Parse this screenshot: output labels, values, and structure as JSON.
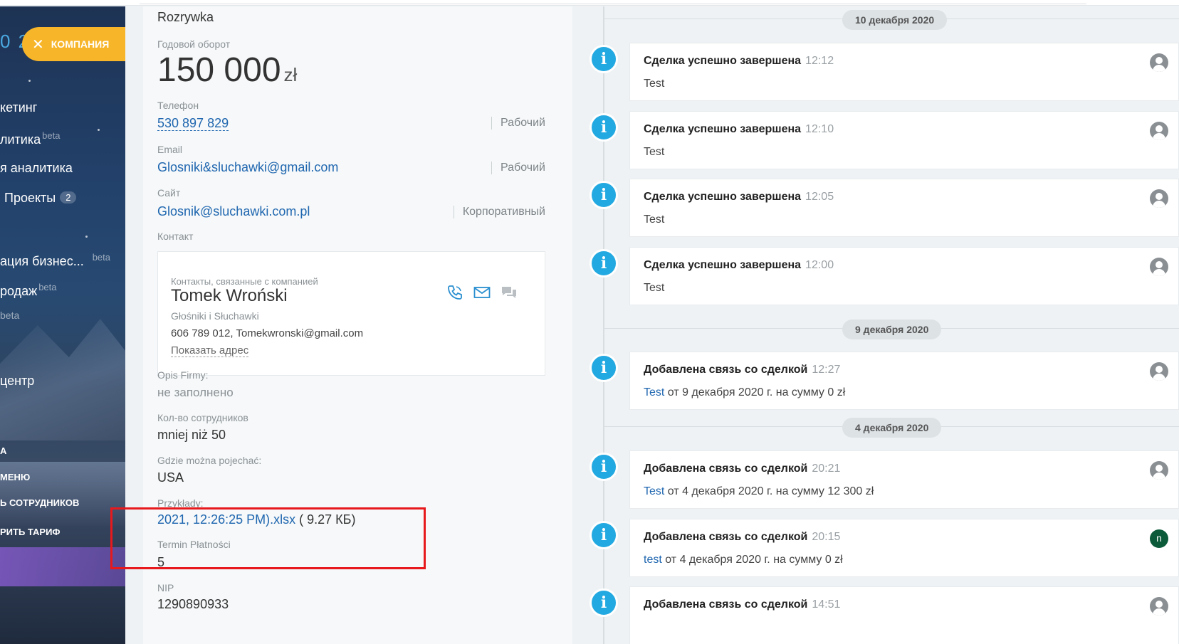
{
  "sidebar": {
    "logo_fragment": "0 2",
    "company_button": "КОМПАНИЯ",
    "items": [
      {
        "label": "кетинг",
        "sup": ""
      },
      {
        "label": "литика",
        "sup": "beta"
      },
      {
        "label": "я аналитика",
        "sup": ""
      },
      {
        "label": "Проекты",
        "sup": "",
        "badge": "2"
      },
      {
        "label": "ация бизнес...",
        "sup": "beta"
      },
      {
        "label": "родаж",
        "sup": "beta"
      },
      {
        "label": "beta",
        "sup": ""
      },
      {
        "label": "центр",
        "sup": ""
      }
    ],
    "small_items": [
      "А",
      "МЕНЮ",
      "Ь СОТРУДНИКОВ",
      "РИТЬ ТАРИФ"
    ]
  },
  "company": {
    "category": "Rozrywka",
    "turnover_label": "Годовой оборот",
    "turnover_value": "150 000",
    "turnover_currency": "zł",
    "phone_label": "Телефон",
    "phone_value": "530 897 829",
    "phone_tag": "Рабочий",
    "email_label": "Email",
    "email_value": "Glosniki&sluchawki@gmail.com",
    "email_tag": "Рабочий",
    "site_label": "Сайт",
    "site_value": "Glosnik@sluchawki.com.pl",
    "site_tag": "Корпоративный",
    "contact_label": "Контакт",
    "contact": {
      "sub": "Контакты, связанные с компанией",
      "name": "Tomek Wroński",
      "org": "Głośniki i Słuchawki",
      "details": "606 789 012, Tomekwronski@gmail.com",
      "address_link": "Показать адрес"
    },
    "opis_label": "Opis Firmy:",
    "opis_value": "не заполнено",
    "employees_label": "Кол-во сотрудников",
    "employees_value": "mniej niż 50",
    "where_label": "Gdzie można pojechać:",
    "where_value": "USA",
    "examples_label": "Przykłady:",
    "examples_file": "2021, 12:26:25 PM).xlsx",
    "examples_size": "( 9.27 КБ)",
    "termin_label": "Termin Płatności",
    "termin_value": "5",
    "nip_label": "NIP",
    "nip_value": "1290890933"
  },
  "timeline": {
    "dates": [
      "10 декабря 2020",
      "9 декабря 2020",
      "4 декабря 2020"
    ],
    "events": [
      {
        "title": "Сделка успешно завершена",
        "time": "12:12",
        "link": "",
        "body": "Test",
        "avatar": "user"
      },
      {
        "title": "Сделка успешно завершена",
        "time": "12:10",
        "link": "",
        "body": "Test",
        "avatar": "user"
      },
      {
        "title": "Сделка успешно завершена",
        "time": "12:05",
        "link": "",
        "body": "Test",
        "avatar": "user"
      },
      {
        "title": "Сделка успешно завершена",
        "time": "12:00",
        "link": "",
        "body": "Test",
        "avatar": "user"
      },
      {
        "title": "Добавлена связь со сделкой",
        "time": "12:27",
        "link": "Test",
        "body": " от 9 декабря 2020 г. на сумму 0 zł",
        "avatar": "user"
      },
      {
        "title": "Добавлена связь со сделкой",
        "time": "20:21",
        "link": "Test",
        "body": " от 4 декабря 2020 г. на сумму 12 300 zł",
        "avatar": "user"
      },
      {
        "title": "Добавлена связь со сделкой",
        "time": "20:15",
        "link": "test",
        "body": " от 4 декабря 2020 г. на сумму 0 zł",
        "avatar": "n"
      },
      {
        "title": "Добавлена связь со сделкой",
        "time": "14:51",
        "link": "",
        "body": "",
        "avatar": "user"
      }
    ]
  },
  "colors": {
    "accent": "#23a9e1",
    "link": "#2067b0",
    "company_button": "#f7b52a",
    "highlight": "#e8191c"
  }
}
